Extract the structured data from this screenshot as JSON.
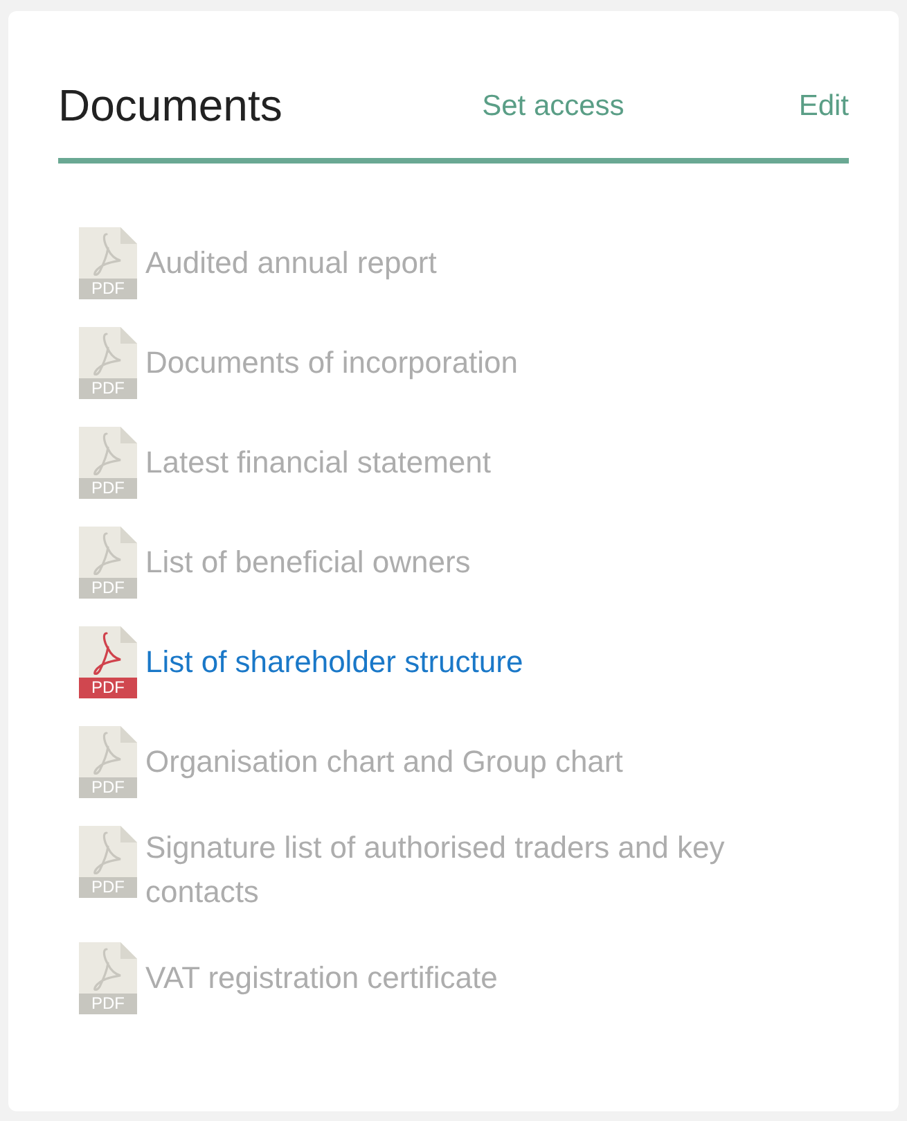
{
  "panel": {
    "title": "Documents",
    "actions": [
      {
        "label": "Set access"
      },
      {
        "label": "Edit"
      }
    ]
  },
  "documents": [
    {
      "name": "Audited annual report",
      "badge": "PDF",
      "disabled": true
    },
    {
      "name": "Documents of incorporation",
      "badge": "PDF",
      "disabled": true
    },
    {
      "name": "Latest financial statement",
      "badge": "PDF",
      "disabled": true
    },
    {
      "name": "List of beneficial owners",
      "badge": "PDF",
      "disabled": true
    },
    {
      "name": "List of shareholder structure",
      "badge": "PDF",
      "disabled": false
    },
    {
      "name": "Organisation chart and Group chart",
      "badge": "PDF",
      "disabled": true
    },
    {
      "name": "Signature list of authorised traders and key contacts",
      "badge": "PDF",
      "disabled": true
    },
    {
      "name": "VAT registration certificate",
      "badge": "PDF",
      "disabled": true
    }
  ]
}
